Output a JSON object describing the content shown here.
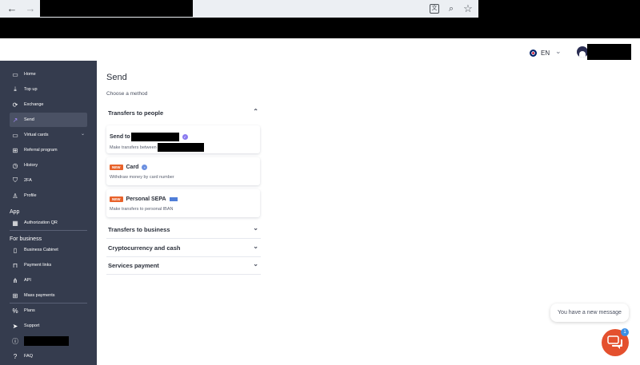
{
  "browser": {
    "back_icon": "arrow-left-icon",
    "forward_icon": "arrow-right-icon",
    "icons": [
      "translate-icon",
      "zoom-icon",
      "bookmark-star-icon"
    ]
  },
  "header": {
    "language": "EN",
    "language_icon": "uk-flag-icon"
  },
  "sidebar": {
    "items": [
      {
        "label": "Home",
        "icon": "wallet-icon"
      },
      {
        "label": "Top up",
        "icon": "download-icon"
      },
      {
        "label": "Exchange",
        "icon": "exchange-icon"
      },
      {
        "label": "Send",
        "icon": "send-arrow-icon",
        "active": true
      },
      {
        "label": "Virtual cards",
        "icon": "card-icon"
      },
      {
        "label": "Referral program",
        "icon": "gift-icon"
      },
      {
        "label": "History",
        "icon": "history-icon"
      },
      {
        "label": "2FA",
        "icon": "shield-icon"
      },
      {
        "label": "Profile",
        "icon": "user-icon"
      }
    ],
    "section_app": "App",
    "app_items": [
      {
        "label": "Authorization QR",
        "icon": "qr-icon"
      }
    ],
    "section_business": "For business",
    "business_items": [
      {
        "label": "Business Cabinet",
        "icon": "building-icon"
      },
      {
        "label": "Payment links",
        "icon": "bag-icon"
      },
      {
        "label": "API",
        "icon": "api-icon"
      },
      {
        "label": "Mass payments",
        "icon": "grid-icon"
      }
    ],
    "bottom_items": [
      {
        "label": "Plans",
        "icon": "percent-icon"
      },
      {
        "label": "Support",
        "icon": "paper-plane-icon"
      },
      {
        "label": "",
        "icon": "info-icon"
      },
      {
        "label": "FAQ",
        "icon": "question-icon"
      }
    ]
  },
  "main": {
    "title": "Send",
    "subtitle": "Choose a method",
    "group_people": "Transfers to people",
    "cards": [
      {
        "title": "Send to",
        "subtitle": "Make transfers between",
        "badge": "",
        "icon": "verified-icon"
      },
      {
        "title": "Card",
        "subtitle": "Withdraw money by card number",
        "badge": "NEW",
        "icon": "card-chip-icon"
      },
      {
        "title": "Personal SEPA",
        "subtitle": "Make transfers to personal IBAN",
        "badge": "NEW",
        "icon": "sepa-icon"
      }
    ],
    "groups_collapsed": [
      "Transfers to business",
      "Cryptocurrency and cash",
      "Services payment"
    ]
  },
  "chat": {
    "message": "You have a new message",
    "count": "1"
  },
  "colors": {
    "sidebar_bg": "#353c4e",
    "active_item_bg": "#4a5164",
    "accent_purple": "#a58cff",
    "badge_orange": "#e8622a",
    "chat_orange": "#e4502e"
  }
}
